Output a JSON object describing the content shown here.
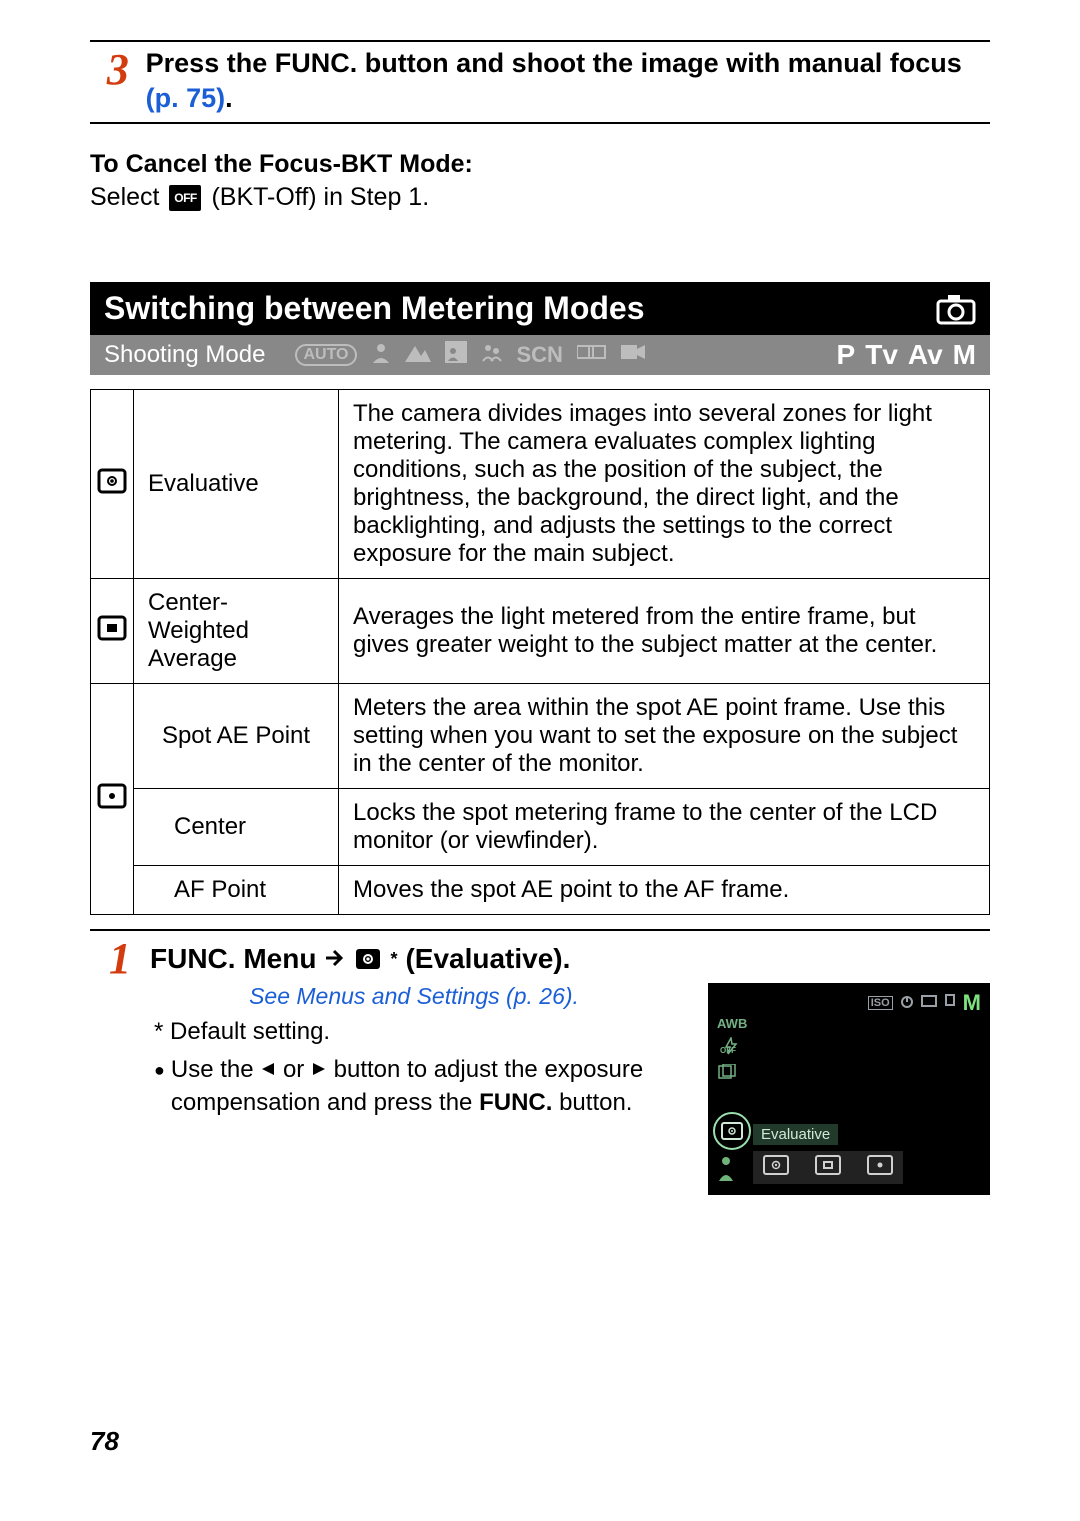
{
  "step3": {
    "number": "3",
    "text_part1": "Press the ",
    "text_func": "FUNC.",
    "text_part2": " button and shoot the image with manual focus ",
    "link": "(p. 75)",
    "period": "."
  },
  "cancel": {
    "heading": "To Cancel the Focus-BKT Mode:",
    "before": "Select ",
    "icon_text": "OFF",
    "after": " (BKT-Off) in Step 1."
  },
  "section_title": "Switching between Metering Modes",
  "mode_bar": {
    "label": "Shooting Mode",
    "auto": "AUTO",
    "scn": "SCN",
    "modes": [
      "P",
      "Tv",
      "Av",
      "M"
    ]
  },
  "metering": [
    {
      "name": "Evaluative",
      "desc": "The camera divides images into several zones for light metering. The camera evaluates complex lighting conditions, such as the position of the subject, the brightness, the background, the direct light, and the backlighting, and adjusts the settings to the correct exposure for the main subject."
    },
    {
      "name": "Center-Weighted Average",
      "desc": "Averages the light metered from the entire frame, but gives greater weight to the subject matter at the center."
    },
    {
      "name": "Spot AE Point",
      "desc": "Meters the area within the spot AE point frame. Use this setting when you want to set the exposure on the subject in the center of the monitor."
    },
    {
      "name": "Center",
      "desc": "Locks the spot metering frame to the center of the LCD monitor (or viewfinder)."
    },
    {
      "name": "AF Point",
      "desc": "Moves the spot AE point to the AF frame."
    }
  ],
  "step1": {
    "number": "1",
    "func_menu": "FUNC. Menu",
    "evaluative": "(Evaluative).",
    "see_menus": "See Menus and Settings (p. 26).",
    "default": "* Default setting.",
    "bullet_before": "Use the ",
    "bullet_mid": " or ",
    "bullet_after": " button to adjust the exposure compensation and press the ",
    "func_bold": "FUNC.",
    "bullet_end": " button."
  },
  "lcd": {
    "top_iso": "ISO",
    "top_m": "M",
    "awb": "AWB",
    "off": "OFF",
    "selected_label": "Evaluative"
  },
  "page_number": "78"
}
